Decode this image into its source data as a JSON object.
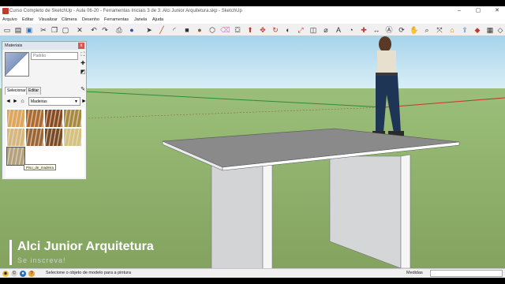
{
  "window": {
    "title": "Curso Completo de SketchUp - Aula 06-20 - Ferramentas Iniciais 3 de 3: Alci Junior Arquitetura.skp - SketchUp",
    "minimize": "–",
    "maximize": "▢",
    "close": "✕"
  },
  "menu": [
    "Arquivo",
    "Editar",
    "Visualizar",
    "Câmera",
    "Desenho",
    "Ferramentas",
    "Janela",
    "Ajuda"
  ],
  "toolbar": {
    "icons": [
      "new-file-icon",
      "open-file-icon",
      "save-icon",
      "cut-icon",
      "copy-icon",
      "paste-icon",
      "erase-icon",
      "undo-icon",
      "redo-icon",
      "print-icon",
      "model-info-icon",
      "select-icon",
      "line-icon",
      "arc-icon",
      "rectangle-icon",
      "circle-icon",
      "polygon-icon",
      "eraser-icon",
      "paint-bucket-icon",
      "push-pull-icon",
      "move-icon",
      "rotate-icon",
      "follow-me-icon",
      "scale-icon",
      "offset-icon",
      "tape-measure-icon",
      "text-icon",
      "protractor-icon",
      "axes-icon",
      "dimension-icon",
      "3d-text-icon",
      "orbit-icon",
      "pan-icon",
      "zoom-icon",
      "zoom-extents-icon",
      "warehouse-icon",
      "share-model-icon",
      "extension-warehouse-icon",
      "layout-icon",
      "ruby-console-icon"
    ]
  },
  "materials_panel": {
    "title": "Materiais",
    "close": "x",
    "material_name": "Padrão",
    "tab_select": "Selecionar",
    "tab_edit": "Editar",
    "library": "Madeiras",
    "tooltip": "Piso_de_madeira",
    "swatch_colors": [
      "#e0a555",
      "#b06a2e",
      "#8a4a1e",
      "#a88a3c",
      "#d9b77a",
      "#9c6532",
      "#7a4a22",
      "#d6c27a",
      "#b5a27a"
    ]
  },
  "overlay": {
    "brand_name": "Alci Junior Arquitetura",
    "brand_sub": "Se inscreva!"
  },
  "statusbar": {
    "message": "Selecione o objeto de modelo para a pintura",
    "measure_label": "Medidas"
  },
  "colors": {
    "sky": "#bfe1f1",
    "ground": "#8fae6a",
    "table_top": "#8a8a8a",
    "table_leg": "#d2d4d6"
  }
}
